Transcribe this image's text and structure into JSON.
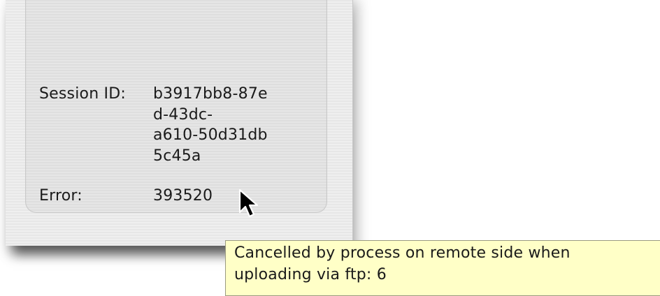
{
  "panel": {
    "session_label": "Session ID:",
    "session_value_lines": [
      "b3917bb8-87e",
      "d-43dc-",
      "a610-50d31db",
      "5c45a"
    ],
    "error_label": "Error:",
    "error_value": "393520"
  },
  "tooltip": {
    "lines": [
      "Cancelled by process on remote side when",
      "uploading via ftp: 6"
    ],
    "background": "#ffffc7"
  },
  "cursor": {
    "icon": "arrow-pointer-icon"
  }
}
